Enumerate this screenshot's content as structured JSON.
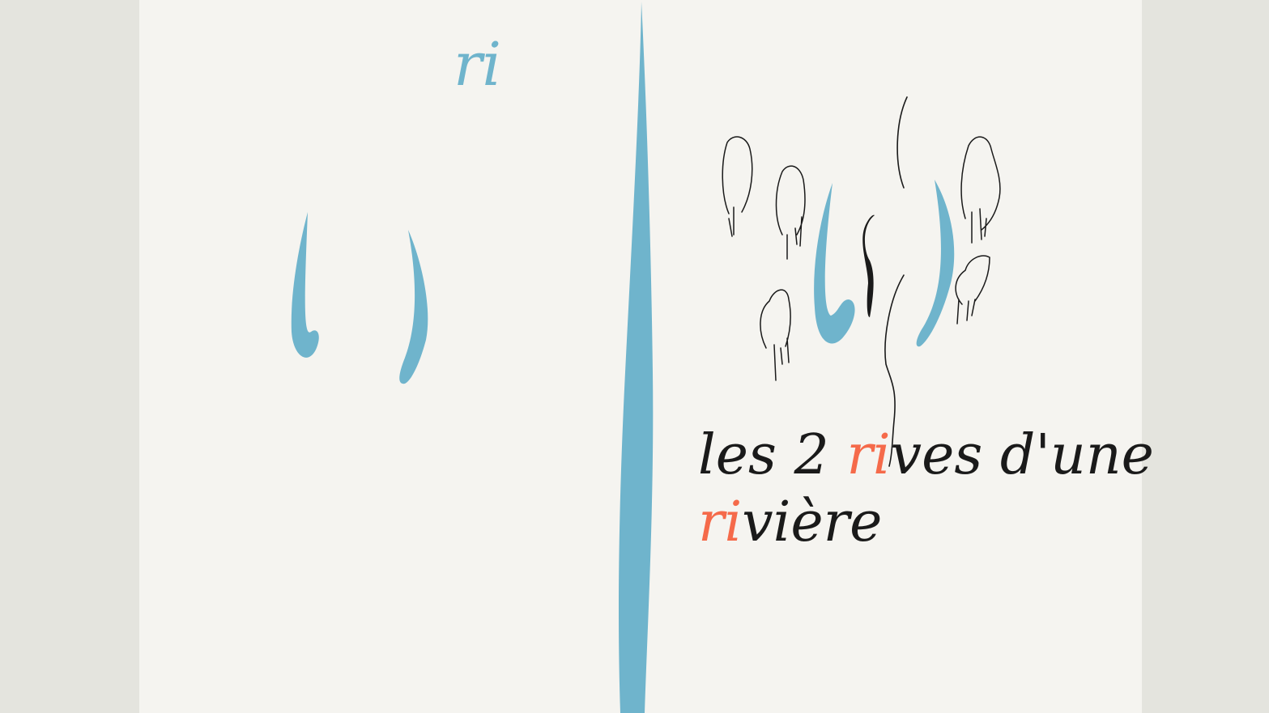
{
  "drawing": {
    "left_syllable": "ri",
    "caption_line1": {
      "before": "les 2 ",
      "highlight": "ri",
      "after": "ves d'une"
    },
    "caption_line2": {
      "highlight": "ri",
      "after": "vière"
    }
  },
  "colors": {
    "background_margin": "#e4e4de",
    "paper": "#f5f4f0",
    "river_blue": "#6fb4cc",
    "highlight_orange": "#f56a4a",
    "ink_black": "#1a1a1a"
  }
}
